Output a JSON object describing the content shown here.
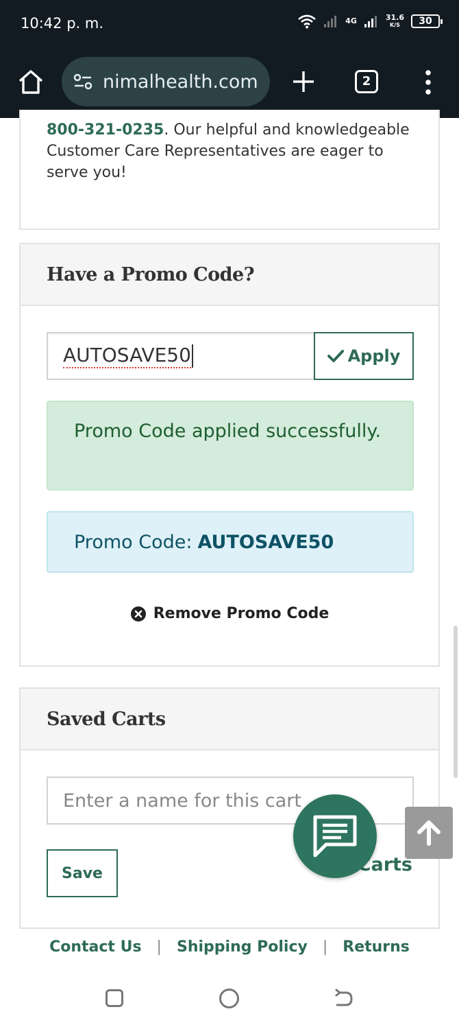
{
  "status_bar": {
    "time": "10:42 p. m.",
    "network": "4G",
    "speed_value": "31.6",
    "speed_unit": "K/S",
    "battery": "30"
  },
  "browser": {
    "url": "nimalhealth.com",
    "tab_count": "2"
  },
  "info": {
    "phone": "800-321-0235",
    "text": ". Our helpful and knowledgeable Customer Care Representatives are eager to serve you!"
  },
  "promo": {
    "heading": "Have a Promo Code?",
    "input_value": "AUTOSAVE50",
    "apply_label": "Apply",
    "success_message": "Promo Code applied successfully.",
    "info_label": "Promo Code:",
    "info_code": "AUTOSAVE50",
    "remove_label": "Remove Promo Code"
  },
  "saved_carts": {
    "heading": "Saved Carts",
    "name_placeholder": "Enter a name for this cart",
    "save_label": "Save",
    "view_label": "ved Carts"
  },
  "footer": {
    "links": [
      "Contact Us",
      "Shipping Policy",
      "Returns"
    ],
    "separator": "|"
  },
  "colors": {
    "accent": "#2e6b57",
    "success_bg": "#d4ecdb",
    "info_bg": "#dff1f8",
    "chrome_bg": "#121b22"
  }
}
